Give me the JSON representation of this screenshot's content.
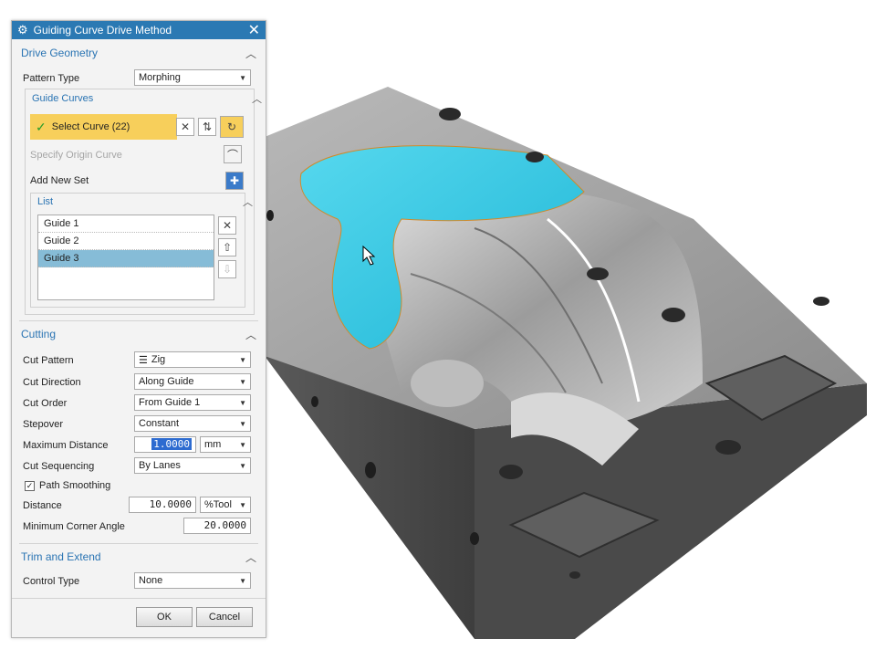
{
  "dialog": {
    "title": "Guiding Curve Drive Method",
    "close": "✕"
  },
  "drive_geometry": {
    "heading": "Drive Geometry",
    "pattern_type_label": "Pattern Type",
    "pattern_type_value": "Morphing",
    "guide_curves": {
      "heading": "Guide Curves",
      "select_curve": "Select Curve (22)",
      "specify_origin": "Specify Origin Curve",
      "add_new_set": "Add New Set",
      "list_heading": "List",
      "items": [
        "Guide  1",
        "Guide  2",
        "Guide  3"
      ],
      "selected_index": 2
    }
  },
  "cutting": {
    "heading": "Cutting",
    "cut_pattern_label": "Cut Pattern",
    "cut_pattern_value": "Zig",
    "cut_direction_label": "Cut Direction",
    "cut_direction_value": "Along Guide",
    "cut_order_label": "Cut Order",
    "cut_order_value": "From Guide 1",
    "stepover_label": "Stepover",
    "stepover_value": "Constant",
    "max_distance_label": "Maximum Distance",
    "max_distance_value": "1.0000",
    "max_distance_unit": "mm",
    "cut_sequencing_label": "Cut Sequencing",
    "cut_sequencing_value": "By Lanes",
    "path_smoothing_label": "Path Smoothing",
    "path_smoothing_checked": true,
    "distance_label": "Distance",
    "distance_value": "10.0000",
    "distance_unit": "%Tool",
    "min_corner_label": "Minimum Corner Angle",
    "min_corner_value": "20.0000"
  },
  "trim_extend": {
    "heading": "Trim and Extend",
    "control_type_label": "Control Type",
    "control_type_value": "None"
  },
  "footer": {
    "ok": "OK",
    "cancel": "Cancel"
  },
  "colors": {
    "title_bar": "#2b79b3",
    "section_heading": "#2a74b3",
    "select_highlight": "#f7cf5b",
    "list_selection": "#86bcd7",
    "guide_surface": "#39c9e3",
    "part_metal": "#8c8c8c"
  }
}
